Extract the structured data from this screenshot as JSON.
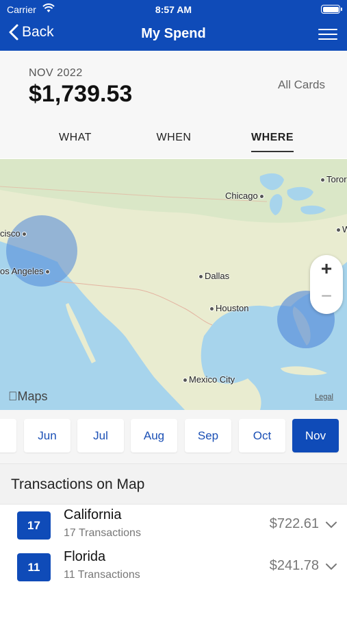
{
  "status_bar": {
    "carrier": "Carrier",
    "time": "8:57 AM"
  },
  "nav": {
    "back_label": "Back",
    "title": "My Spend"
  },
  "summary": {
    "month": "NOV 2022",
    "amount": "$1,739.53",
    "card_filter": "All Cards"
  },
  "tabs": [
    {
      "label": "WHAT",
      "active": false
    },
    {
      "label": "WHEN",
      "active": false
    },
    {
      "label": "WHERE",
      "active": true
    }
  ],
  "map": {
    "cities": {
      "toronto": "Toror",
      "chicago": "Chicago",
      "san_francisco": "cisco",
      "los_angeles": "os Angeles",
      "dallas": "Dallas",
      "houston": "Houston",
      "mexico_city": "Mexico City",
      "east": "W"
    },
    "zoom_in": "+",
    "zoom_out": "−",
    "attribution": "Maps",
    "legal": "Legal"
  },
  "months": [
    {
      "label": "y",
      "active": false
    },
    {
      "label": "Jun",
      "active": false
    },
    {
      "label": "Jul",
      "active": false
    },
    {
      "label": "Aug",
      "active": false
    },
    {
      "label": "Sep",
      "active": false
    },
    {
      "label": "Oct",
      "active": false
    },
    {
      "label": "Nov",
      "active": true
    }
  ],
  "transactions": {
    "header": "Transactions on Map",
    "items": [
      {
        "count": "17",
        "name": "California",
        "subtitle": "17 Transactions",
        "amount": "$722.61"
      },
      {
        "count": "11",
        "name": "Florida",
        "subtitle": "11 Transactions",
        "amount": "$241.78"
      }
    ]
  },
  "colors": {
    "brand": "#0f4bb8",
    "map_water": "#a7d4ec",
    "map_land": "#e9ecd0",
    "bubble": "#4f86d9"
  }
}
